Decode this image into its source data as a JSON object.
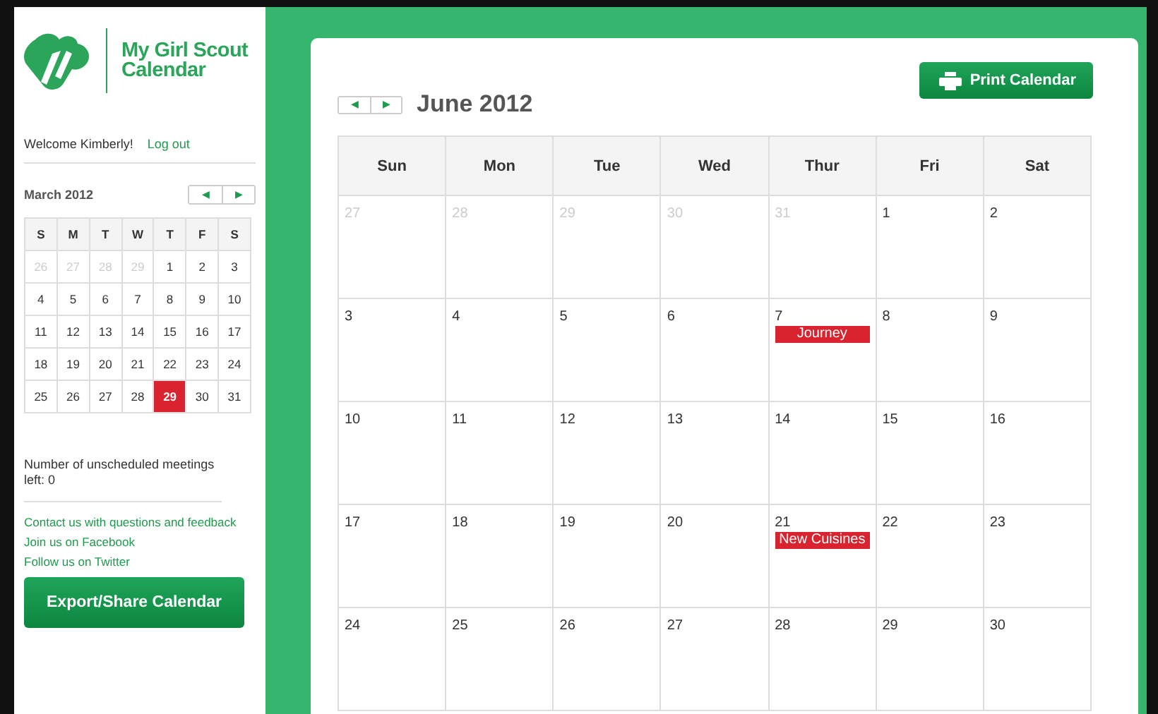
{
  "sidebar": {
    "logo_text": "My Girl Scout Calendar",
    "welcome": "Welcome Kimberly!",
    "logout": "Log out",
    "mini_calendar": {
      "title": "March 2012",
      "prev": "◀",
      "next": "▶",
      "weekdays": [
        "S",
        "M",
        "T",
        "W",
        "T",
        "F",
        "S"
      ],
      "days": [
        {
          "day": "26",
          "muted": true,
          "selected": false
        },
        {
          "day": "27",
          "muted": true,
          "selected": false
        },
        {
          "day": "28",
          "muted": true,
          "selected": false
        },
        {
          "day": "29",
          "muted": true,
          "selected": false
        },
        {
          "day": "1",
          "muted": false,
          "selected": false
        },
        {
          "day": "2",
          "muted": false,
          "selected": false
        },
        {
          "day": "3",
          "muted": false,
          "selected": false
        },
        {
          "day": "4",
          "muted": false,
          "selected": false
        },
        {
          "day": "5",
          "muted": false,
          "selected": false
        },
        {
          "day": "6",
          "muted": false,
          "selected": false
        },
        {
          "day": "7",
          "muted": false,
          "selected": false
        },
        {
          "day": "8",
          "muted": false,
          "selected": false
        },
        {
          "day": "9",
          "muted": false,
          "selected": false
        },
        {
          "day": "10",
          "muted": false,
          "selected": false
        },
        {
          "day": "11",
          "muted": false,
          "selected": false
        },
        {
          "day": "12",
          "muted": false,
          "selected": false
        },
        {
          "day": "13",
          "muted": false,
          "selected": false
        },
        {
          "day": "14",
          "muted": false,
          "selected": false
        },
        {
          "day": "15",
          "muted": false,
          "selected": false
        },
        {
          "day": "16",
          "muted": false,
          "selected": false
        },
        {
          "day": "17",
          "muted": false,
          "selected": false
        },
        {
          "day": "18",
          "muted": false,
          "selected": false
        },
        {
          "day": "19",
          "muted": false,
          "selected": false
        },
        {
          "day": "20",
          "muted": false,
          "selected": false
        },
        {
          "day": "21",
          "muted": false,
          "selected": false
        },
        {
          "day": "22",
          "muted": false,
          "selected": false
        },
        {
          "day": "23",
          "muted": false,
          "selected": false
        },
        {
          "day": "24",
          "muted": false,
          "selected": false
        },
        {
          "day": "25",
          "muted": false,
          "selected": false
        },
        {
          "day": "26",
          "muted": false,
          "selected": false
        },
        {
          "day": "27",
          "muted": false,
          "selected": false
        },
        {
          "day": "28",
          "muted": false,
          "selected": false
        },
        {
          "day": "29",
          "muted": false,
          "selected": true
        },
        {
          "day": "30",
          "muted": false,
          "selected": false
        },
        {
          "day": "31",
          "muted": false,
          "selected": false
        }
      ]
    },
    "unscheduled": "Number of unscheduled meetings left: 0",
    "links": [
      "Contact us with questions and feedback",
      "Join us on Facebook",
      "Follow us on Twitter"
    ],
    "export_button": "Export/Share Calendar"
  },
  "main": {
    "prev": "◀",
    "next": "▶",
    "title": "June 2012",
    "print_button": "Print Calendar",
    "weekdays": [
      "Sun",
      "Mon",
      "Tue",
      "Wed",
      "Thur",
      "Fri",
      "Sat"
    ],
    "days": [
      {
        "day": "27",
        "muted": true
      },
      {
        "day": "28",
        "muted": true
      },
      {
        "day": "29",
        "muted": true
      },
      {
        "day": "30",
        "muted": true
      },
      {
        "day": "31",
        "muted": true
      },
      {
        "day": "1",
        "muted": false
      },
      {
        "day": "2",
        "muted": false
      },
      {
        "day": "3",
        "muted": false
      },
      {
        "day": "4",
        "muted": false
      },
      {
        "day": "5",
        "muted": false
      },
      {
        "day": "6",
        "muted": false
      },
      {
        "day": "7",
        "muted": false,
        "events": [
          "Journey"
        ]
      },
      {
        "day": "8",
        "muted": false
      },
      {
        "day": "9",
        "muted": false
      },
      {
        "day": "10",
        "muted": false
      },
      {
        "day": "11",
        "muted": false
      },
      {
        "day": "12",
        "muted": false
      },
      {
        "day": "13",
        "muted": false
      },
      {
        "day": "14",
        "muted": false
      },
      {
        "day": "15",
        "muted": false
      },
      {
        "day": "16",
        "muted": false
      },
      {
        "day": "17",
        "muted": false
      },
      {
        "day": "18",
        "muted": false
      },
      {
        "day": "19",
        "muted": false
      },
      {
        "day": "20",
        "muted": false
      },
      {
        "day": "21",
        "muted": false,
        "events": [
          "New Cuisines"
        ]
      },
      {
        "day": "22",
        "muted": false
      },
      {
        "day": "23",
        "muted": false
      },
      {
        "day": "24",
        "muted": false
      },
      {
        "day": "25",
        "muted": false
      },
      {
        "day": "26",
        "muted": false
      },
      {
        "day": "27",
        "muted": false
      },
      {
        "day": "28",
        "muted": false
      },
      {
        "day": "29",
        "muted": false
      },
      {
        "day": "30",
        "muted": false
      }
    ]
  }
}
